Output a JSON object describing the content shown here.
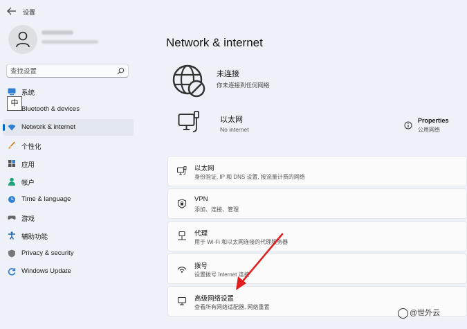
{
  "window": {
    "title": "设置"
  },
  "search": {
    "placeholder": "查找设置"
  },
  "sidebar": {
    "items": [
      {
        "label": "系统"
      },
      {
        "label": "Bluetooth & devices"
      },
      {
        "label": "Network & internet"
      },
      {
        "label": "个性化"
      },
      {
        "label": "应用"
      },
      {
        "label": "帐户"
      },
      {
        "label": "Time & language"
      },
      {
        "label": "游戏"
      },
      {
        "label": "辅助功能"
      },
      {
        "label": "Privacy & security"
      },
      {
        "label": "Windows Update"
      }
    ]
  },
  "ime": {
    "label": "中"
  },
  "main": {
    "title": "Network & internet",
    "status": {
      "title": "未连接",
      "subtitle": "你未连接到任何网络"
    },
    "ethernet": {
      "title": "以太网",
      "subtitle": "No internet",
      "properties_label": "Properties",
      "properties_sub": "公用网络"
    },
    "cards": [
      {
        "title": "以太网",
        "subtitle": "身份验证, IP 和 DNS 设置, 按流量计费的网络"
      },
      {
        "title": "VPN",
        "subtitle": "添加、连接、管理"
      },
      {
        "title": "代理",
        "subtitle": "用于 Wi-Fi 和以太网连接的代理服务器"
      },
      {
        "title": "拨号",
        "subtitle": "设置拨号 Internet 连接"
      },
      {
        "title": "高级网络设置",
        "subtitle": "查看所有网络适配器, 网络重置"
      }
    ]
  },
  "watermark": {
    "text": "@世外云"
  },
  "colors": {
    "accent": "#0067c0",
    "arrow": "#e02020",
    "background": "#eef2f8"
  }
}
